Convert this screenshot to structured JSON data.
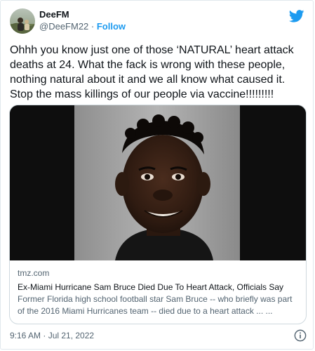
{
  "user": {
    "display_name": "DeeFM",
    "handle": "@DeeFM22",
    "separator": " · ",
    "follow_label": "Follow"
  },
  "tweet": {
    "text": "Ohhh you know just one of those ‘NATURAL’ heart attack deaths at 24. What the fack is wrong with these people, nothing natural about it and we all know what caused it. Stop the mass killings of our people via vaccine!!!!!!!!!",
    "timestamp": "9:16 AM · Jul 21, 2022"
  },
  "card": {
    "domain": "tmz.com",
    "title": "Ex-Miami Hurricane Sam Bruce Died Due To Heart Attack, Officials Say",
    "description": "Former Florida high school football star Sam Bruce -- who briefly was part of the 2016 Miami Hurricanes team -- died due to a heart attack ... ..."
  },
  "icons": {
    "brand": "twitter-bird-icon",
    "info": "info-icon"
  },
  "colors": {
    "brand_blue": "#1d9bf0",
    "text_primary": "#0f1419",
    "text_secondary": "#536471",
    "border": "#cfd9de"
  }
}
